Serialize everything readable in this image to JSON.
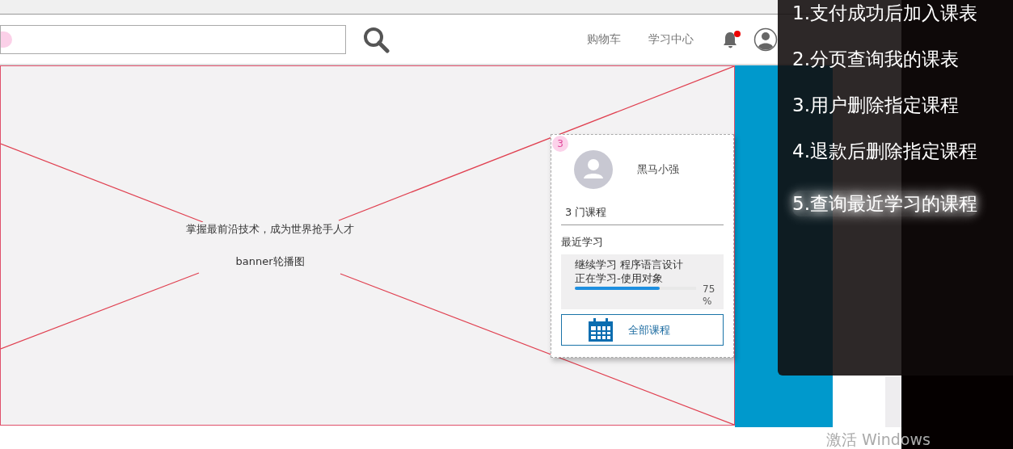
{
  "header": {
    "nav_links": [
      "购物车",
      "学习中心"
    ],
    "bell": {
      "unread": true
    }
  },
  "banner": {
    "headline": "掌握最前沿技术，成为世界抢手人才",
    "caption": "banner轮播图"
  },
  "popup": {
    "badge": "3",
    "user_name": "黑马小强",
    "course_count": "3 门课程",
    "recent_title": "最近学习",
    "recent": {
      "line_1": "继续学习 程序语言设计",
      "line_2": "正在学习-使用对象",
      "level": 0.7,
      "percent": "75 %"
    },
    "all_courses_button": "全部课程"
  },
  "overlay": {
    "items": [
      {
        "text": "1.支付成功后加入课表",
        "highlighted": false
      },
      {
        "text": "2.分页查询我的课表",
        "highlighted": false
      },
      {
        "text": "3.用户删除指定课程",
        "highlighted": false
      },
      {
        "text": "4.退款后删除指定课程",
        "highlighted": false
      },
      {
        "text": "5.查询最近学习的课程",
        "highlighted": true
      }
    ]
  },
  "os_notice": "激活 Windows"
}
